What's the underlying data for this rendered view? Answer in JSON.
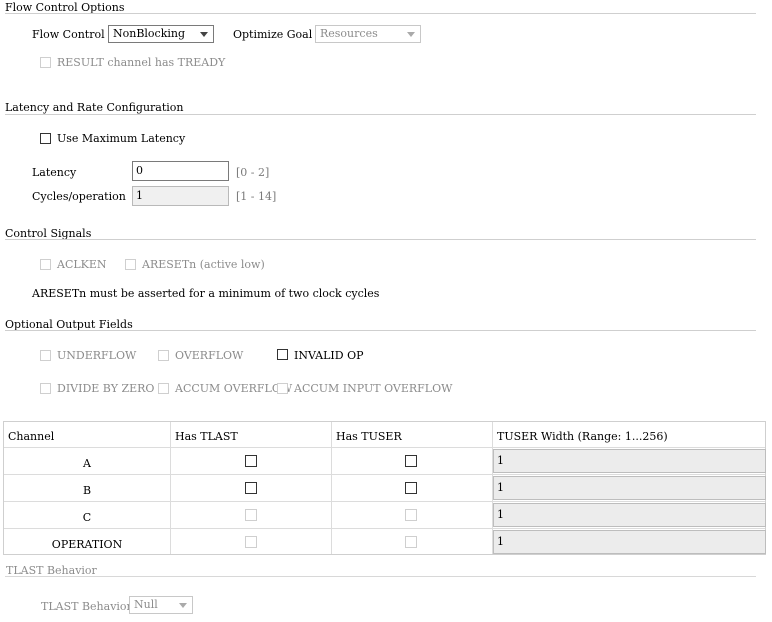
{
  "flow_control_options": {
    "title": "Flow Control Options",
    "flow_control_label": "Flow Control",
    "flow_control_value": "NonBlocking",
    "optimize_goal_label": "Optimize Goal",
    "optimize_goal_value": "Resources",
    "result_tready_label": "RESULT channel has TREADY"
  },
  "latency_rate": {
    "title": "Latency and Rate Configuration",
    "use_max_latency_label": "Use Maximum Latency",
    "latency_label": "Latency",
    "latency_value": "0",
    "latency_range": "[0 - 2]",
    "cycles_label": "Cycles/operation",
    "cycles_value": "1",
    "cycles_range": "[1 - 14]"
  },
  "control_signals": {
    "title": "Control Signals",
    "aclken_label": "ACLKEN",
    "aresetn_label": "ARESETn (active low)",
    "note": "ARESETn must be asserted for a minimum of two clock cycles"
  },
  "optional_output_fields": {
    "title": "Optional Output Fields",
    "underflow_label": "UNDERFLOW",
    "overflow_label": "OVERFLOW",
    "invalid_op_label": "INVALID OP",
    "divide_by_zero_label": "DIVIDE BY ZERO",
    "accum_overflow_label": "ACCUM OVERFLOW",
    "accum_input_overflow_label": "ACCUM INPUT OVERFLOW"
  },
  "channel_table": {
    "headers": [
      "Channel",
      "Has TLAST",
      "Has TUSER",
      "TUSER Width (Range: 1...256)"
    ],
    "rows": [
      {
        "channel": "A",
        "tuser_width": "1"
      },
      {
        "channel": "B",
        "tuser_width": "1"
      },
      {
        "channel": "C",
        "tuser_width": "1"
      },
      {
        "channel": "OPERATION",
        "tuser_width": "1"
      }
    ]
  },
  "tlast_behavior": {
    "title": "TLAST Behavior",
    "label": "TLAST Behavior",
    "value": "Null"
  }
}
